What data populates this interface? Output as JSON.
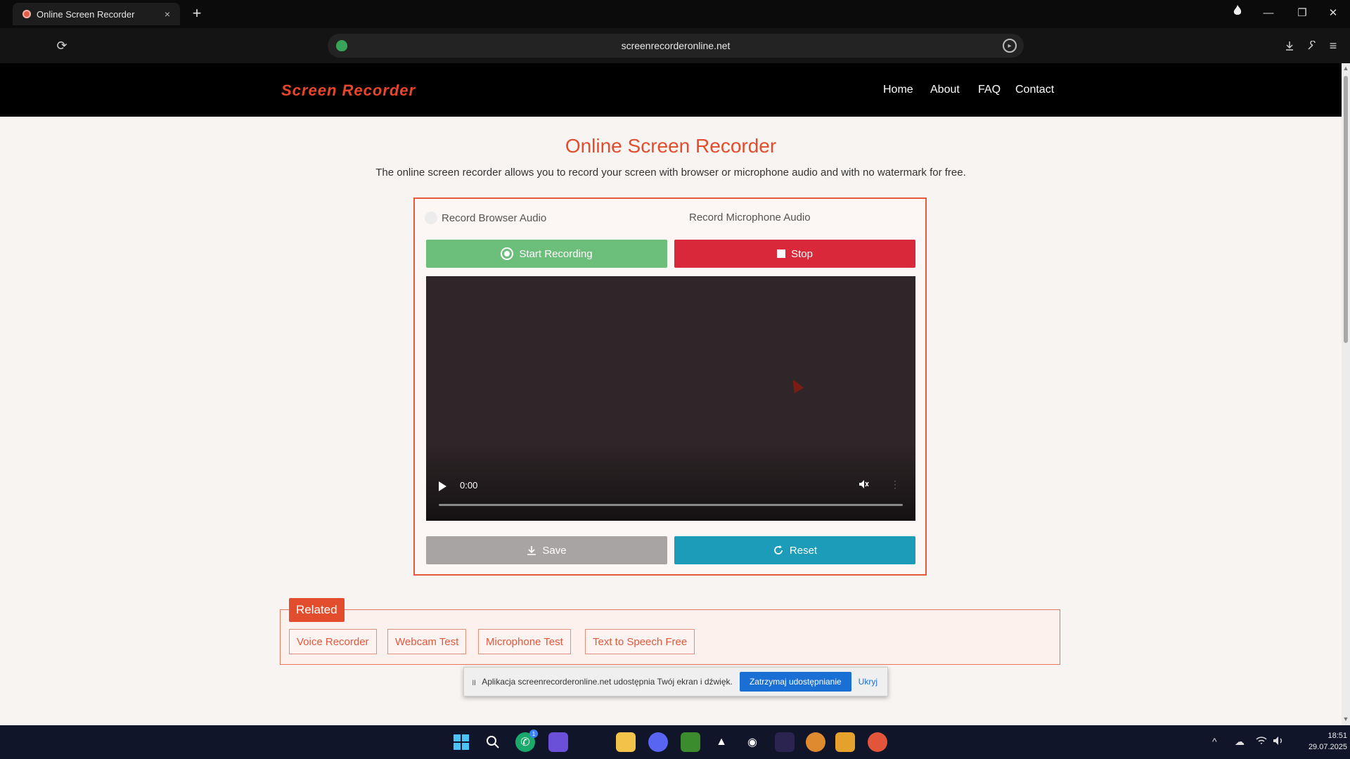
{
  "browser": {
    "tab_title": "Online Screen Recorder",
    "tab_close": "×",
    "new_tab": "+",
    "url": "screenrecorderonline.net",
    "refresh_icon": "refresh-icon",
    "window_controls": [
      "minimize",
      "restore",
      "close"
    ]
  },
  "site": {
    "logo": "Screen Recorder",
    "nav": [
      "Home",
      "About",
      "FAQ",
      "Contact"
    ],
    "title": "Online Screen Recorder",
    "description": "The online screen recorder allows you to record your screen with browser or microphone audio and with no watermark for free."
  },
  "recorder": {
    "browser_audio_label": "Record Browser Audio",
    "mic_audio_label": "Record Microphone Audio",
    "start_label": "Start Recording",
    "stop_label": "Stop",
    "save_label": "Save",
    "reset_label": "Reset",
    "video_time": "0:00",
    "colors": {
      "start": "#6cbf7a",
      "stop": "#d9283a",
      "save": "#a8a4a4",
      "reset": "#1c9cb8",
      "accent": "#e24e2d"
    }
  },
  "related": {
    "heading": "Related",
    "links": [
      "Voice Recorder",
      "Webcam Test",
      "Microphone Test",
      "Text to Speech Free"
    ]
  },
  "share_bar": {
    "text": "Aplikacja screenrecorderonline.net udostępnia Twój ekran i dźwięk.",
    "stop_label": "Zatrzymaj udostępnianie",
    "hide_label": "Ukryj"
  },
  "taskbar": {
    "time": "18:51",
    "date": "29.07.2025",
    "badge": "1"
  }
}
